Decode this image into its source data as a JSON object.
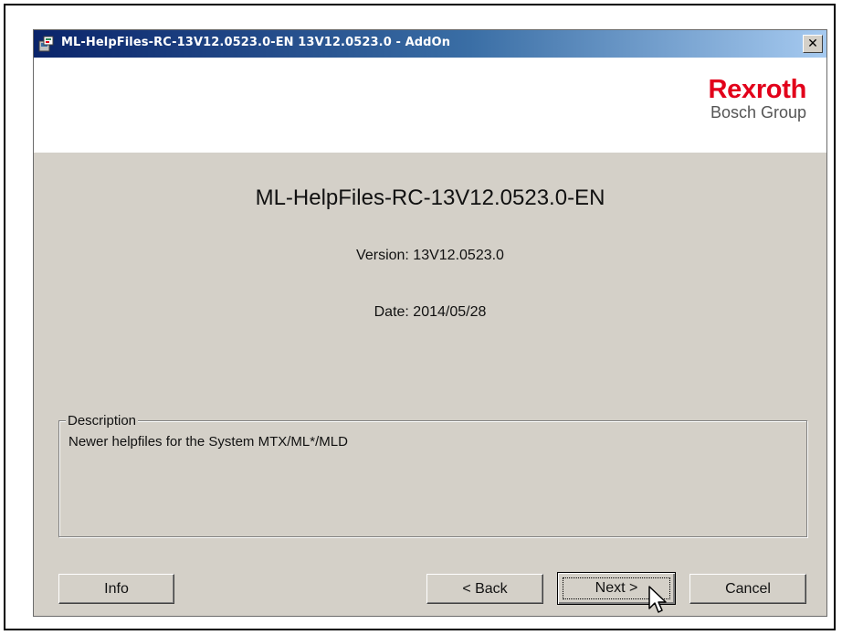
{
  "window": {
    "title": "ML-HelpFiles-RC-13V12.0523.0-EN 13V12.0523.0 - AddOn",
    "close_symbol": "✕"
  },
  "brand": {
    "name": "Rexroth",
    "group": "Bosch Group",
    "color": "#e2001a"
  },
  "product": {
    "title": "ML-HelpFiles-RC-13V12.0523.0-EN",
    "version": "Version: 13V12.0523.0",
    "date": "Date: 2014/05/28"
  },
  "description": {
    "legend": "Description",
    "text": "Newer helpfiles for the System MTX/ML*/MLD"
  },
  "buttons": {
    "info": "Info",
    "back": "< Back",
    "next": "Next >",
    "cancel": "Cancel"
  },
  "icons": {
    "app": "installer-icon",
    "close": "close-icon",
    "cursor": "mouse-pointer-icon"
  }
}
